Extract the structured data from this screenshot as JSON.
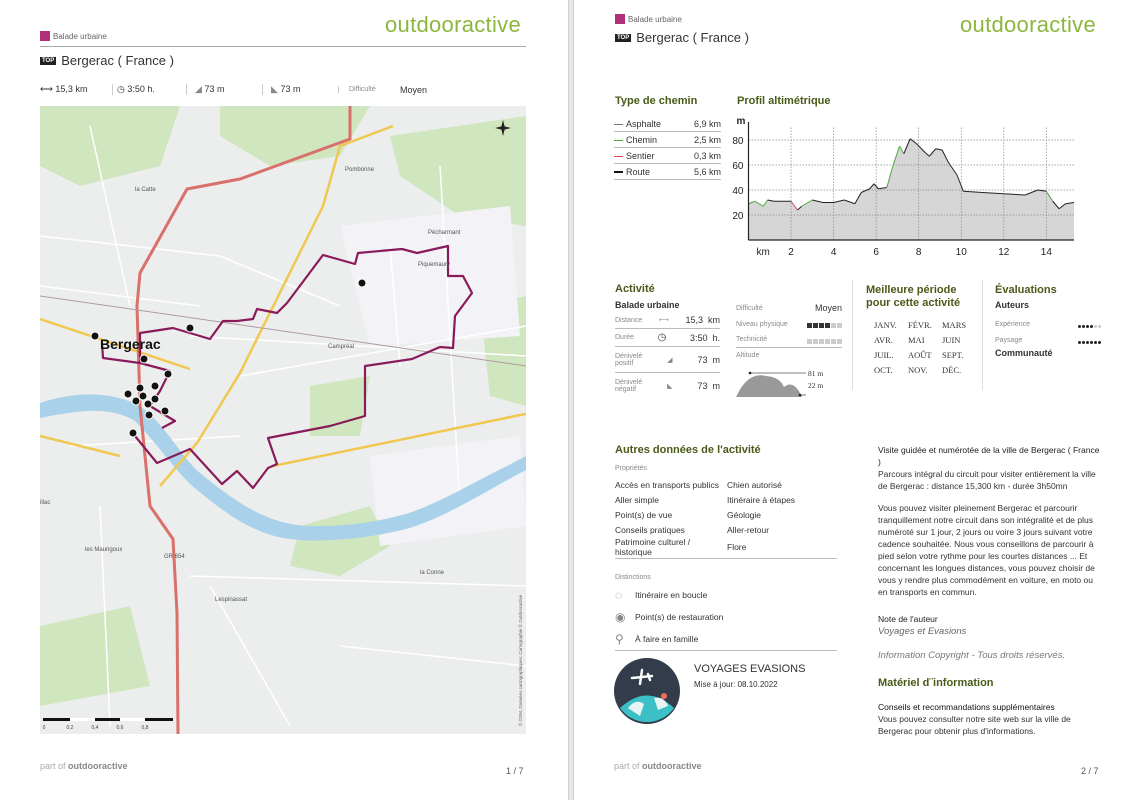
{
  "brand": "outdooractive",
  "page1": {
    "category": "Balade urbaine",
    "badge": "TOP",
    "title": "Bergerac ( France )",
    "stats": {
      "distance": "15,3 km",
      "duration": "3:50 h.",
      "ascent": "73 m",
      "descent": "73 m",
      "difficulty_label": "Difficulté",
      "difficulty": "Moyen"
    },
    "map": {
      "city": "Bergerac",
      "places": [
        "Pombonne",
        "la Catte",
        "Pécharmant",
        "les Maurigoux",
        "la Conne",
        "Lespinassat",
        "Piquemaury",
        "Campréal",
        "illac",
        "GR 654"
      ],
      "copyright": "© OSM, Données cartographiques: Cartographie © Outdooractive",
      "scale": [
        "0",
        "0,2",
        "0,4",
        "0,6",
        "0,8"
      ],
      "route_color": "#8a1a5a"
    },
    "footer": {
      "part_of": "part of",
      "brand": "outdooractive",
      "page": "1 / 7"
    }
  },
  "page2": {
    "category": "Balade urbaine",
    "badge": "TOP",
    "title": "Bergerac ( France )",
    "path_types": {
      "heading": "Type de chemin",
      "items": [
        {
          "label": "Asphalte",
          "value": "6,9 km",
          "color": "#777777"
        },
        {
          "label": "Chemin",
          "value": "2,5 km",
          "color": "#4aa83a"
        },
        {
          "label": "Sentier",
          "value": "0,3 km",
          "color": "#e0405a"
        },
        {
          "label": "Route",
          "value": "5,6 km",
          "color": "#111111"
        }
      ]
    },
    "profile": {
      "heading": "Profil altimétrique",
      "y_unit": "m",
      "x_unit": "km"
    },
    "activity": {
      "heading": "Activité",
      "type": "Balade urbaine",
      "distance_label": "Distance",
      "distance": "15,3  km",
      "duration_label": "Durée",
      "duration": "3:50  h.",
      "ascent_label1": "Dénivelé",
      "ascent_label2": "positif",
      "ascent": "73  m",
      "descent_label1": "Dénivelé",
      "descent_label2": "négatif",
      "descent": "73  m",
      "difficulty_label": "Difficulté",
      "difficulty": "Moyen",
      "fitness_label": "Niveau physique",
      "fitness_level": 4,
      "fitness_max": 6,
      "technique_label": "Technicité",
      "technique_level": 0,
      "technique_max": 6,
      "altitude_label": "Altitude",
      "alt_max": "81 m",
      "alt_min": "22 m"
    },
    "season": {
      "heading1": "Meilleure période",
      "heading2": "pour cette activité",
      "months": [
        "JANV.",
        "FÉVR.",
        "MARS",
        "AVR.",
        "MAI",
        "JUIN",
        "JUIL.",
        "AOÛT",
        "SEPT.",
        "OCT.",
        "NOV.",
        "DÉC."
      ]
    },
    "ratings": {
      "heading": "Évaluations",
      "authors": "Auteurs",
      "experience_label": "Expérience",
      "experience": 4,
      "landscape_label": "Paysage",
      "landscape": 6,
      "max": 6,
      "community": "Communauté"
    },
    "other": {
      "heading": "Autres données de l'activité",
      "properties_label": "Propriétés",
      "properties": [
        [
          "Accès en transports publics",
          "Chien autorisé"
        ],
        [
          "Aller simple",
          "Itinéraire à étapes"
        ],
        [
          "Point(s) de vue",
          "Géologie"
        ],
        [
          "Conseils pratiques",
          "Aller-retour"
        ],
        [
          "Patrimoine culturel / historique",
          "Flore"
        ]
      ],
      "distinctions_label": "Distinctions",
      "distinctions": [
        {
          "icon": "loop-icon",
          "label": "Itinéraire en boucle"
        },
        {
          "icon": "restaurant-icon",
          "label": "Point(s) de restauration"
        },
        {
          "icon": "family-icon",
          "label": "À faire en famille"
        }
      ]
    },
    "author": {
      "name": "VOYAGES EVASIONS",
      "updated": "Mise à jour: 08.10.2022"
    },
    "description": {
      "title": "Visite guidée et numérotée de la ville de Bergerac ( France )",
      "p1": "Parcours intégral du circuit pour visiter entièrement la ville de Bergerac : distance 15,300 km - durée 3h50mn",
      "p2": "Vous pouvez visiter pleinement Bergerac et parcourir tranquillement notre circuit dans son intégralité et de plus numéroté sur 1 jour, 2 jours ou voire 3 jours suivant votre cadence souhaitée. Nous vous conseillons de parcourir à pied selon votre rythme pour les courtes distances ... Et concernant les longues distances, vous pouvez choisir de vous y rendre plus commodément en voiture, en moto ou en transports en commun."
    },
    "author_note": {
      "label": "Note de l'auteur",
      "text": "Voyages et Evasions"
    },
    "copyright": "Information Copyright - Tous droits réservés.",
    "material": {
      "heading": "Matériel d¨information",
      "sub": "Conseils et recommandations supplémentaires",
      "text": "Vous pouvez consulter notre site web sur la ville de Bergerac pour obtenir plus d'informations."
    },
    "footer": {
      "part_of": "part of",
      "brand": "outdooractive",
      "page": "2 / 7"
    }
  },
  "chart_data": {
    "type": "area",
    "title": "Profil altimétrique",
    "xlabel": "km",
    "ylabel": "m",
    "xlim": [
      0,
      15.3
    ],
    "ylim": [
      0,
      90
    ],
    "xticks": [
      2,
      4,
      6,
      8,
      10,
      12,
      14
    ],
    "yticks": [
      20,
      40,
      60,
      80
    ],
    "grid": true,
    "x": [
      0,
      0.3,
      0.7,
      0.9,
      1.2,
      2,
      2.3,
      2.5,
      3,
      3.5,
      4,
      4.5,
      5,
      5.3,
      5.7,
      5.9,
      6.1,
      6.5,
      6.8,
      7.1,
      7.3,
      7.6,
      7.9,
      8.3,
      8.5,
      8.8,
      9.1,
      9.4,
      9.8,
      10.1,
      11,
      12,
      13,
      13.6,
      14,
      14.3,
      14.6,
      14.9,
      15.3
    ],
    "y": [
      29,
      31,
      27,
      32,
      31,
      31,
      24,
      27,
      32,
      30,
      30,
      32,
      29,
      38,
      41,
      45,
      41,
      42,
      60,
      75,
      69,
      81,
      77,
      70,
      67,
      73,
      72,
      62,
      52,
      39,
      38,
      37,
      36,
      40,
      39,
      31,
      25,
      29,
      30
    ]
  }
}
